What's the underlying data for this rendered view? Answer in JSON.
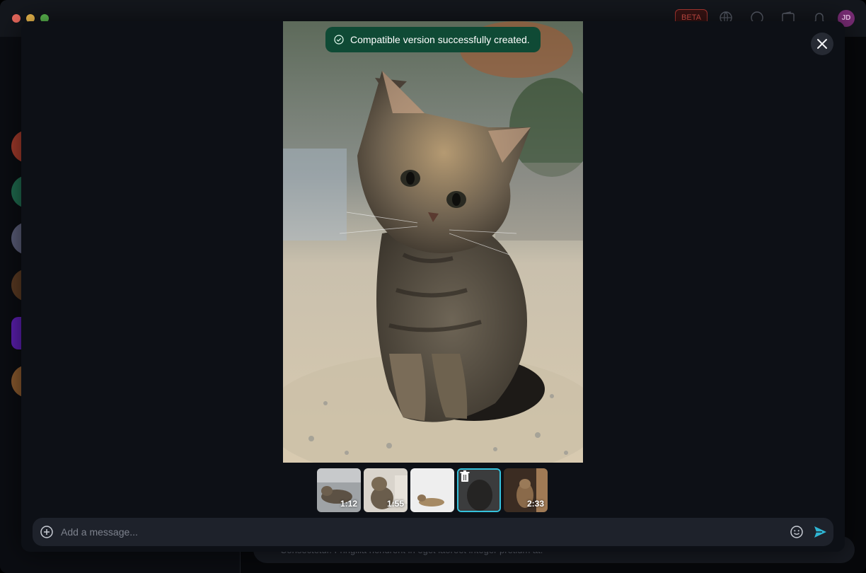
{
  "window": {
    "beta_label": "BETA",
    "user_initials": "JD"
  },
  "background_chat": {
    "composer_text": "Consectetur. Fringilla hendrerit in eget laoreet integer pretium at."
  },
  "toast": {
    "message": "Compatible version successfully created.",
    "icon": "check-circle-icon"
  },
  "viewer": {
    "close_icon": "close-icon",
    "thumbnails": [
      {
        "duration": "1:12",
        "selected": false
      },
      {
        "duration": "1:55",
        "selected": false
      },
      {
        "duration": "",
        "selected": false
      },
      {
        "duration": "",
        "selected": true,
        "overlay_icon": "trash-icon"
      },
      {
        "duration": "2:33",
        "selected": false
      }
    ]
  },
  "composer": {
    "placeholder": "Add a message...",
    "add_icon": "plus-circle-icon",
    "emoji_icon": "smiley-icon",
    "send_icon": "send-icon"
  },
  "colors": {
    "toast_bg": "#0f4a35",
    "selected_thumb_border": "#35c2dc",
    "send_accent": "#2fb6d4",
    "beta_red": "#e2554d"
  }
}
